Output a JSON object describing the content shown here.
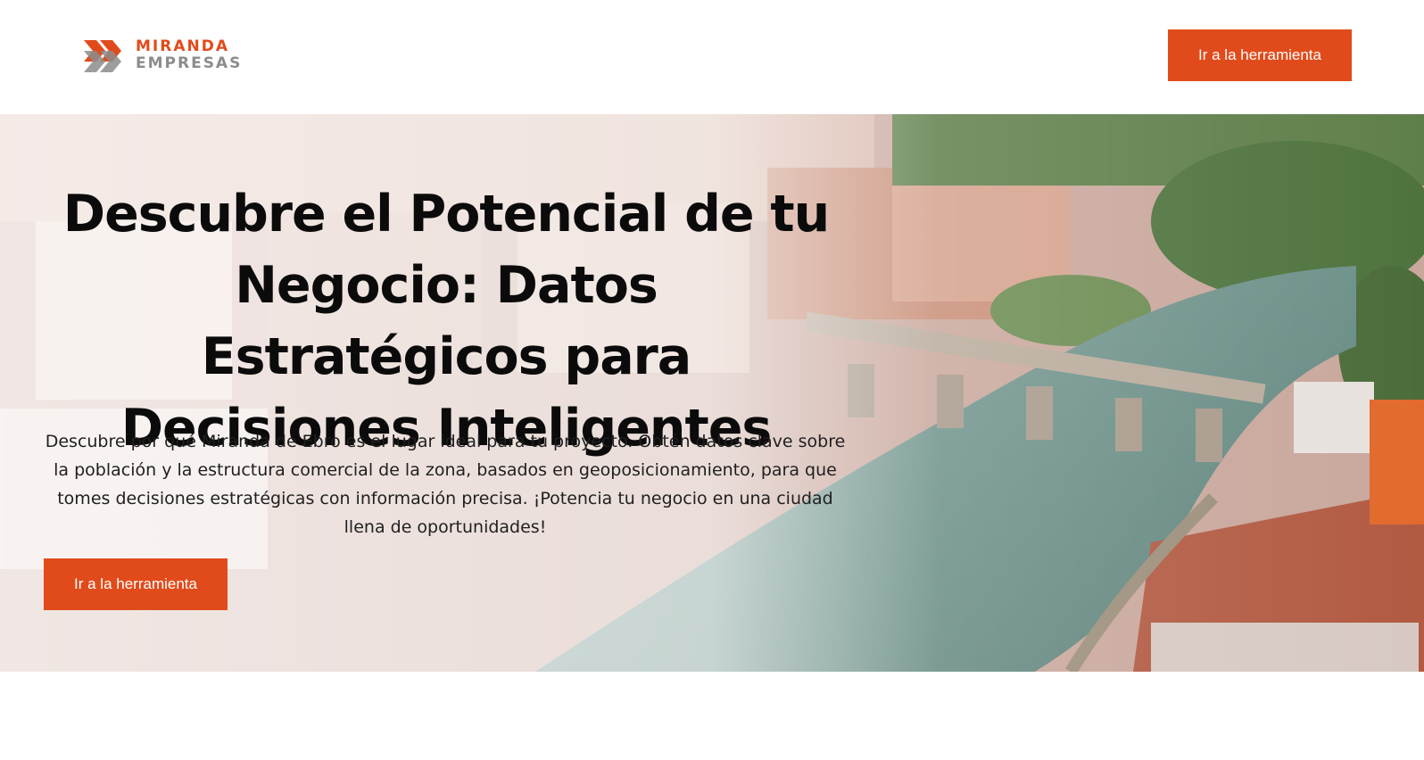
{
  "header": {
    "logo": {
      "line1": "MIRANDA",
      "line2": "EMPRESAS",
      "icon": "chevron-arrows-logo-icon"
    },
    "cta_label": "Ir a la herramienta"
  },
  "hero": {
    "title": "Descubre el Potencial de tu Negocio: Datos Estratégicos para Decisiones Inteligentes",
    "description": "Descubre por qué Miranda de Ebro es el lugar ideal para tu proyecto. Obtén datos clave sobre la población y la estructura comercial de la zona, basados en geoposicionamiento, para que tomes decisiones estratégicas con información precisa. ¡Potencia tu negocio en una ciudad llena de oportunidades!",
    "cta_label": "Ir a la herramienta",
    "background": "aerial-city-river-bridge-image"
  },
  "colors": {
    "accent": "#e14b1b",
    "logo_gray": "#8c8c8c",
    "text": "#0b0b0b"
  }
}
